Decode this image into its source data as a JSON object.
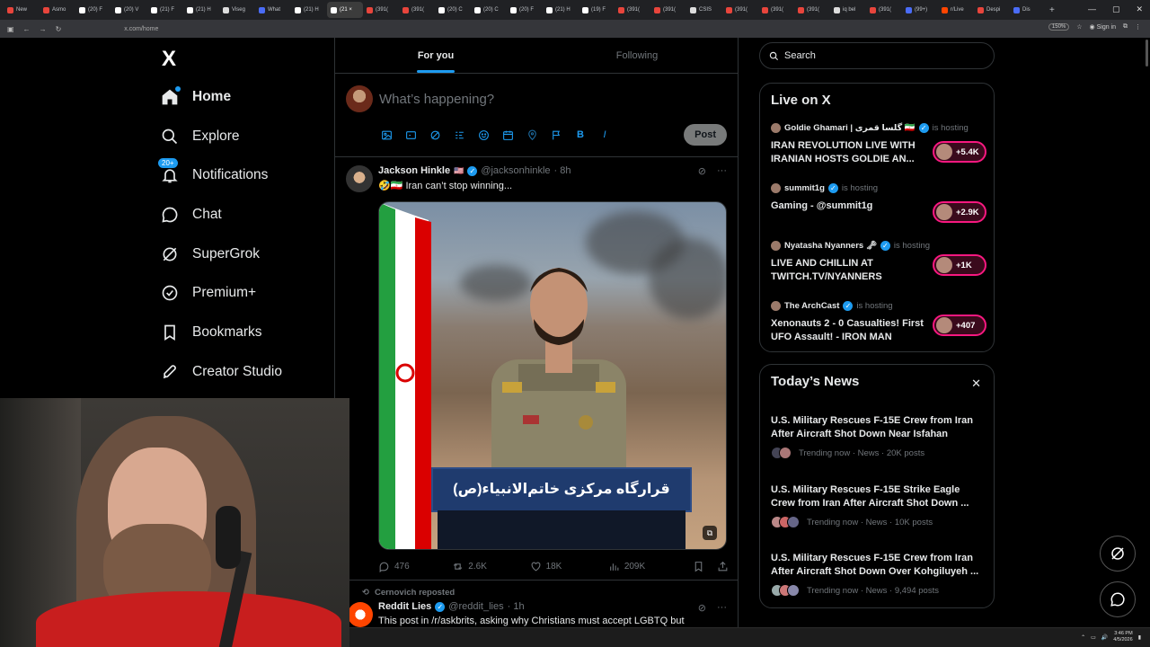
{
  "browser": {
    "tabs": [
      {
        "label": "New",
        "color": "#e8453c"
      },
      {
        "label": "Asmo",
        "color": "#e8453c"
      },
      {
        "label": "(20) F",
        "color": "#fff"
      },
      {
        "label": "(20) V",
        "color": "#fff"
      },
      {
        "label": "(21) F",
        "color": "#fff"
      },
      {
        "label": "(21) H",
        "color": "#fff"
      },
      {
        "label": "Viseg",
        "color": "#ddd"
      },
      {
        "label": "What",
        "color": "#4a6cf7"
      },
      {
        "label": "(21) H",
        "color": "#fff"
      },
      {
        "label": "(21 ×",
        "color": "#fff"
      },
      {
        "label": "(391(",
        "color": "#e8453c"
      },
      {
        "label": "(391(",
        "color": "#e8453c"
      },
      {
        "label": "(20) C",
        "color": "#fff"
      },
      {
        "label": "(20) C",
        "color": "#fff"
      },
      {
        "label": "(20) F",
        "color": "#fff"
      },
      {
        "label": "(21) H",
        "color": "#fff"
      },
      {
        "label": "(19) F",
        "color": "#fff"
      },
      {
        "label": "(391(",
        "color": "#e8453c"
      },
      {
        "label": "(391(",
        "color": "#e8453c"
      },
      {
        "label": "CSIS",
        "color": "#ddd"
      },
      {
        "label": "(391(",
        "color": "#e8453c"
      },
      {
        "label": "(391(",
        "color": "#e8453c"
      },
      {
        "label": "(391(",
        "color": "#e8453c"
      },
      {
        "label": "iq bel",
        "color": "#ddd"
      },
      {
        "label": "(391(",
        "color": "#e8453c"
      },
      {
        "label": "(99+)",
        "color": "#4a6cf7"
      },
      {
        "label": "r/Live",
        "color": "#ff4500"
      },
      {
        "label": "Despi",
        "color": "#e8453c"
      },
      {
        "label": "Dis",
        "color": "#4a6cf7"
      }
    ],
    "active_tab": 9,
    "url": "x.com/home",
    "zoom": "150%",
    "sign_in": "Sign in"
  },
  "nav": {
    "logo": "X",
    "badge": "20+",
    "items": [
      {
        "label": "Home",
        "icon": "home-icon"
      },
      {
        "label": "Explore",
        "icon": "search-icon"
      },
      {
        "label": "Notifications",
        "icon": "bell-icon"
      },
      {
        "label": "Chat",
        "icon": "chat-icon"
      },
      {
        "label": "SuperGrok",
        "icon": "grok-icon"
      },
      {
        "label": "Premium+",
        "icon": "premium-icon"
      },
      {
        "label": "Bookmarks",
        "icon": "bookmark-icon"
      },
      {
        "label": "Creator Studio",
        "icon": "rocket-icon"
      }
    ]
  },
  "feed": {
    "tabs": [
      "For you",
      "Following"
    ],
    "compose_placeholder": "What’s happening?",
    "post_label": "Post",
    "tweet1": {
      "name": "Jackson Hinkle",
      "flag": "🇺🇸",
      "handle": "@jacksonhinkle",
      "time": "· 8h",
      "text": "🤣🇮🇷 Iran can’t stop winning...",
      "lectern_text": "قرارگاه مرکزی خاتم‌الانبیاء(ص)",
      "comments": "476",
      "reposts": "2.6K",
      "likes": "18K",
      "views": "209K"
    },
    "tweet2": {
      "repost_by": "Cernovich reposted",
      "name": "Reddit Lies",
      "handle": "@reddit_lies",
      "time": "· 1h",
      "text": "This post in /r/askbrits, asking why Christians must accept LGBTQ but"
    }
  },
  "sidebar": {
    "search_placeholder": "Search",
    "live": {
      "title": "Live on X",
      "items": [
        {
          "host": "Goldie Ghamari | گلسا قمری 🇮🇷",
          "status": "is hosting",
          "title": "IRAN REVOLUTION LIVE WITH IRANIAN HOSTS GOLDIE AN...",
          "count": "+5.4K"
        },
        {
          "host": "summit1g",
          "status": "is hosting",
          "title": "Gaming - @summit1g",
          "count": "+2.9K"
        },
        {
          "host": "Nyatasha Nyanners 🗝",
          "status": "is hosting",
          "title": "LIVE AND CHILLIN AT TWITCH.TV/NYANNERS",
          "count": "+1K"
        },
        {
          "host": "The ArchCast",
          "status": "is hosting",
          "title": "Xenonauts 2 - 0 Casualties! First UFO Assault! - IRON MAN",
          "count": "+407"
        }
      ]
    },
    "news": {
      "title": "Today’s News",
      "items": [
        {
          "title": "U.S. Military Rescues F-15E Crew from Iran After Aircraft Shot Down Near Isfahan",
          "meta": "Trending now · News · 20K posts"
        },
        {
          "title": "U.S. Military Rescues F-15E Strike Eagle Crew from Iran After Aircraft Shot Down ...",
          "meta": "Trending now · News · 10K posts"
        },
        {
          "title": "U.S. Military Rescues F-15E Crew from Iran After Aircraft Shot Down Over Kohgiluyeh ...",
          "meta": "Trending now · News · 9,494 posts"
        }
      ]
    }
  },
  "taskbar": {
    "time": "3:46 PM",
    "date": "4/5/2026"
  },
  "colors": {
    "accent": "#1d9bf0",
    "live_pink": "#f91880",
    "background": "#000000"
  }
}
